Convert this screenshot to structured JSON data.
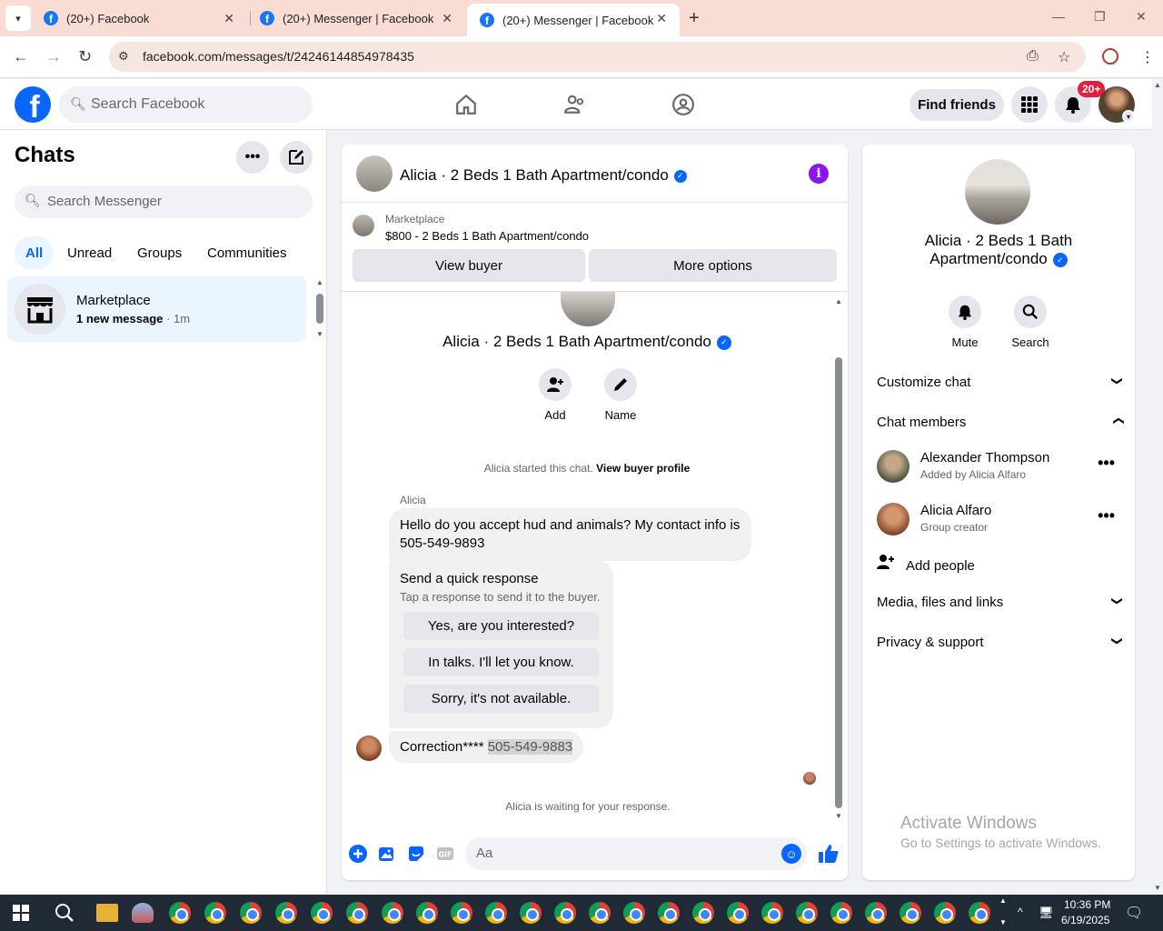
{
  "browser": {
    "tabs": [
      {
        "title": "(20+) Facebook",
        "active": false
      },
      {
        "title": "(20+) Messenger | Facebook",
        "active": false
      },
      {
        "title": "(20+) Messenger | Facebook",
        "active": true
      }
    ],
    "url": "facebook.com/messages/t/24246144854978435"
  },
  "fb_nav": {
    "search_placeholder": "Search Facebook",
    "find_friends": "Find friends",
    "notification_count": "20+"
  },
  "sidebar": {
    "title": "Chats",
    "search_placeholder": "Search Messenger",
    "filters": [
      "All",
      "Unread",
      "Groups",
      "Communities"
    ],
    "active_filter": "All",
    "chats": [
      {
        "name": "Marketplace",
        "preview": "1 new message",
        "time": "1m"
      }
    ]
  },
  "conversation": {
    "title": "Alicia · 2 Beds 1 Bath Apartment/condo",
    "marketplace_label": "Marketplace",
    "listing": "$800 - 2 Beds 1 Bath Apartment/condo",
    "view_buyer": "View buyer",
    "more_options": "More options",
    "actions": [
      {
        "label": "Add"
      },
      {
        "label": "Name"
      }
    ],
    "system_line": "Alicia started this chat.",
    "system_link": "View buyer profile",
    "sender_name": "Alicia",
    "message_1": "Hello do you accept hud and animals? My contact info is 505-549-9893",
    "quick_response": {
      "title": "Send a quick response",
      "subtitle": "Tap a response to send it to the buyer.",
      "options": [
        "Yes, are you interested?",
        "In talks. I'll let you know.",
        "Sorry, it's not available."
      ]
    },
    "message_2_prefix": "Correction****",
    "message_2_highlight": "505-549-9883",
    "waiting": "Alicia is waiting for your response.",
    "composer_placeholder": "Aa"
  },
  "details": {
    "title": "Alicia · 2 Beds 1 Bath Apartment/condo",
    "actions": [
      {
        "label": "Mute"
      },
      {
        "label": "Search"
      }
    ],
    "customize_chat": "Customize chat",
    "chat_members": "Chat members",
    "members": [
      {
        "name": "Alexander Thompson",
        "sub": "Added by Alicia Alfaro"
      },
      {
        "name": "Alicia Alfaro",
        "sub": "Group creator"
      }
    ],
    "add_people": "Add people",
    "media": "Media, files and links",
    "privacy": "Privacy & support"
  },
  "watermark": {
    "line1": "Activate Windows",
    "line2": "Go to Settings to activate Windows."
  },
  "taskbar": {
    "time": "10:36 PM",
    "date": "6/19/2025"
  }
}
